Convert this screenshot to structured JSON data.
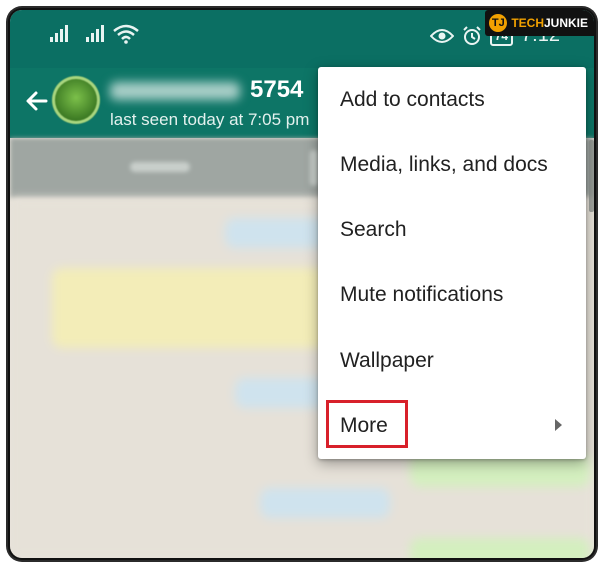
{
  "watermark": {
    "mark": "TJ",
    "brand_prefix": "TECH",
    "brand_suffix": "JUNKIE"
  },
  "status_bar": {
    "battery": "74",
    "time": "7:12"
  },
  "app_bar": {
    "contact_name_visible": "5754",
    "last_seen": "last seen today at 7:05 pm"
  },
  "menu": {
    "items": [
      {
        "label": "Add to contacts"
      },
      {
        "label": "Media, links, and docs"
      },
      {
        "label": "Search"
      },
      {
        "label": "Mute notifications"
      },
      {
        "label": "Wallpaper"
      },
      {
        "label": "More",
        "has_submenu": true,
        "highlighted": true
      }
    ]
  },
  "colors": {
    "status_bar": "#0b6f63",
    "app_bar": "#0d7566",
    "highlight_box": "#d8202a"
  }
}
